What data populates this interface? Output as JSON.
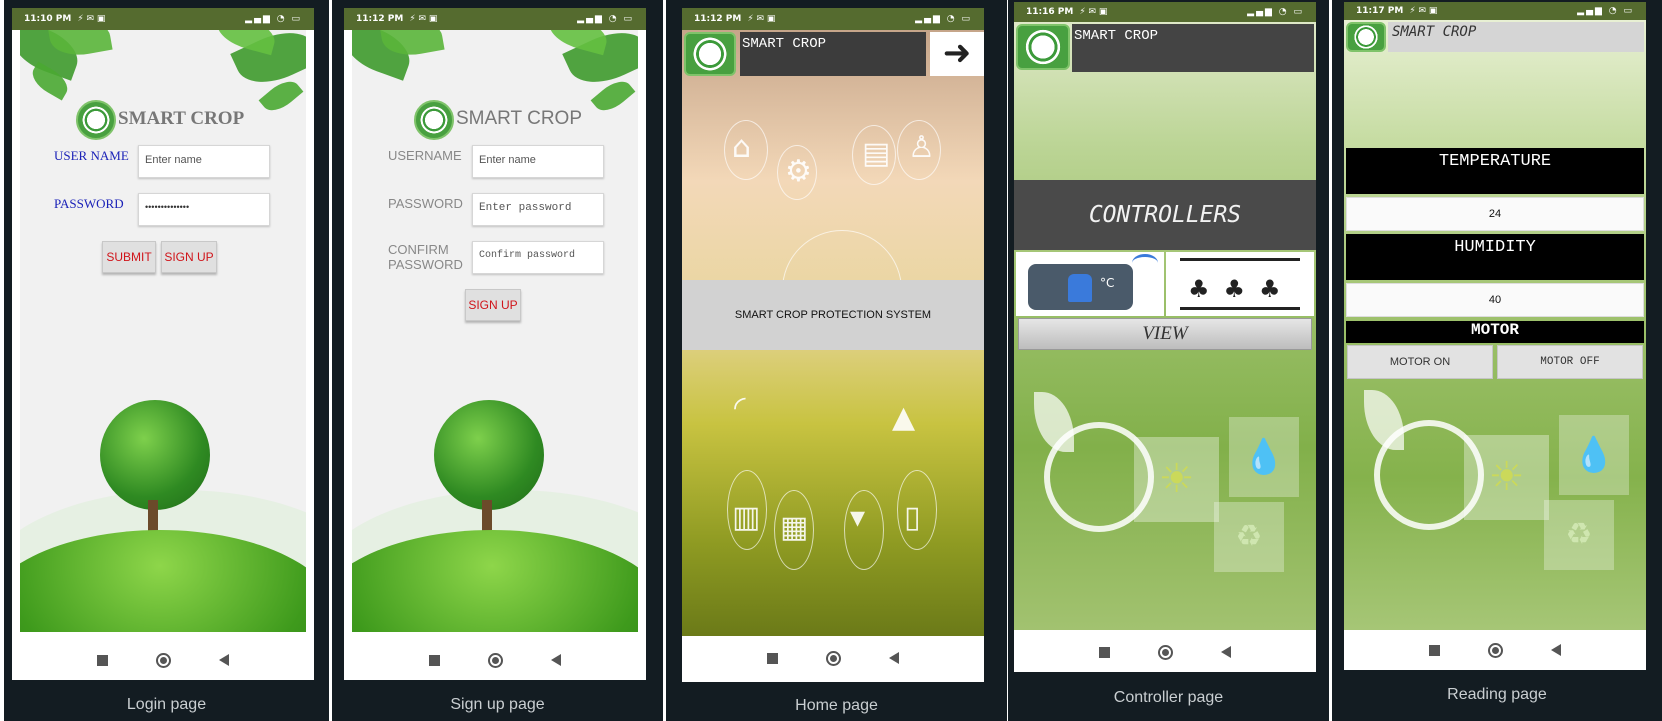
{
  "status_bar": {
    "icons": "⚡ ✉ ▣"
  },
  "login": {
    "time": "11:10 PM",
    "app_name": "SMART CROP",
    "user_label": "USER NAME",
    "user_placeholder": "Enter name",
    "password_label": "PASSWORD",
    "password_value": "••••••••••••••",
    "submit_label": "SUBMIT",
    "signup_label": "SIGN UP",
    "caption": "Login page"
  },
  "signup": {
    "time": "11:12 PM",
    "app_name": "SMART CROP",
    "user_label": "USERNAME",
    "user_placeholder": "Enter name",
    "password_label": "PASSWORD",
    "password_placeholder": "Enter password",
    "confirm_label_1": "CONFIRM",
    "confirm_label_2": "PASSWORD",
    "confirm_placeholder": "Confirm password",
    "signup_label": "SIGN UP",
    "caption": "Sign up page"
  },
  "home": {
    "time": "11:12 PM",
    "app_name": "SMART CROP",
    "banner": "SMART CROP PROTECTION SYSTEM",
    "caption": "Home page"
  },
  "controller": {
    "time": "11:16 PM",
    "app_name": "SMART CROP",
    "title": "CONTROLLERS",
    "view_label": "VIEW",
    "caption": "Controller page"
  },
  "reading": {
    "time": "11:17 PM",
    "app_name": "SMART CROP",
    "temperature_label": "TEMPERATURE",
    "temperature_value": "24",
    "humidity_label": "HUMIDITY",
    "humidity_value": "40",
    "motor_label": "MOTOR",
    "motor_on": "MOTOR ON",
    "motor_off": "MOTOR OFF",
    "caption": "Reading page"
  }
}
